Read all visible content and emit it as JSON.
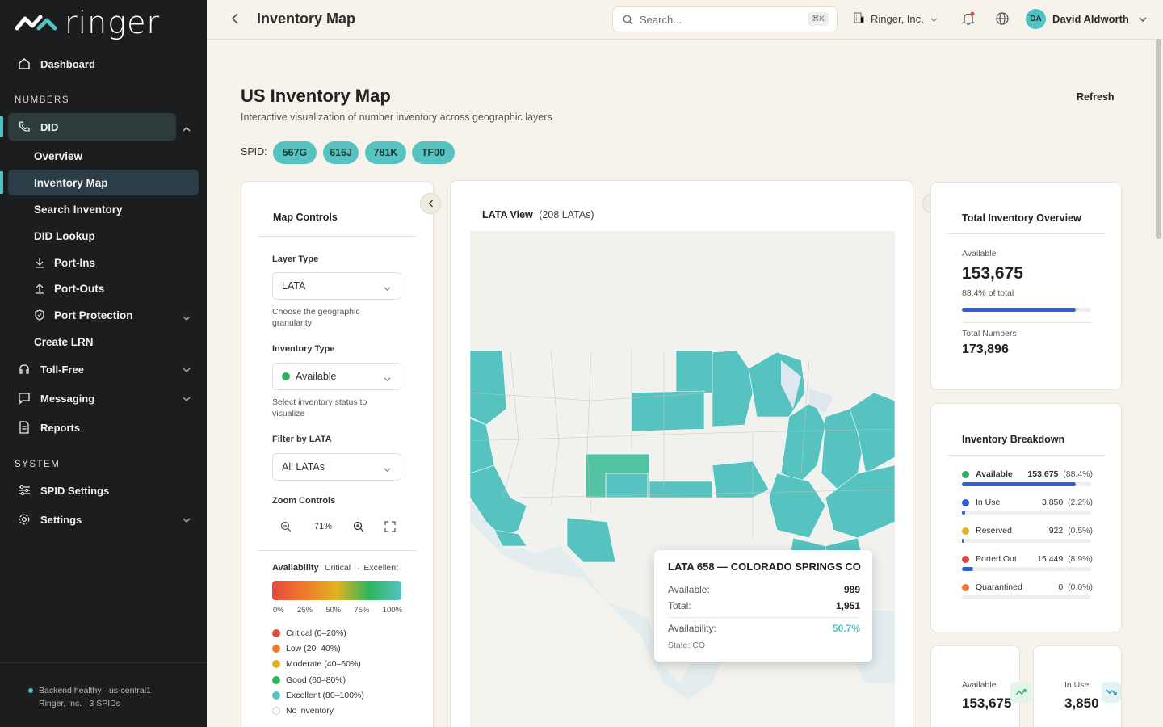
{
  "app": {
    "name": "ringer"
  },
  "sidebar": {
    "dashboard": "Dashboard",
    "numbers_section": "NUMBERS",
    "did": "DID",
    "did_items": [
      "Overview",
      "Inventory Map",
      "Search Inventory",
      "DID Lookup",
      "Port-Ins",
      "Port-Outs",
      "Port Protection",
      "Create LRN"
    ],
    "toll_free": "Toll-Free",
    "messaging": "Messaging",
    "reports": "Reports",
    "system_section": "SYSTEM",
    "spid_settings": "SPID Settings",
    "settings": "Settings",
    "footer": {
      "status": "Backend healthy · us-central1",
      "org": "Ringer, Inc. · 3 SPIDs"
    }
  },
  "topbar": {
    "title": "Inventory Map",
    "search_placeholder": "Search...",
    "search_shortcut": "⌘K",
    "org": "Ringer, Inc.",
    "user_initials": "DA",
    "user_name": "David Aldworth"
  },
  "page": {
    "title": "US Inventory Map",
    "subtitle": "Interactive visualization of number inventory across geographic layers",
    "refresh": "Refresh",
    "spid_label": "SPID:",
    "spids": [
      "567G",
      "616J",
      "781K",
      "TF00"
    ]
  },
  "controls": {
    "title": "Map Controls",
    "layer_type_label": "Layer Type",
    "layer_type_value": "LATA",
    "layer_type_hint": "Choose the geographic granularity",
    "inventory_type_label": "Inventory Type",
    "inventory_type_value": "Available",
    "inventory_type_hint": "Select inventory status to visualize",
    "filter_label": "Filter by LATA",
    "filter_value": "All LATAs",
    "zoom_label": "Zoom Controls",
    "zoom_value": "71%",
    "availability_label": "Availability",
    "availability_range": "Critical → Excellent",
    "scale_ticks": [
      "0%",
      "25%",
      "50%",
      "75%",
      "100%"
    ],
    "legend": [
      {
        "label": "Critical (0–20%)",
        "color": "#e5483f"
      },
      {
        "label": "Low (20–40%)",
        "color": "#f0792a"
      },
      {
        "label": "Moderate (40–60%)",
        "color": "#e2b321"
      },
      {
        "label": "Good (60–80%)",
        "color": "#2db55d"
      },
      {
        "label": "Excellent (80–100%)",
        "color": "#56c3c0"
      },
      {
        "label": "No inventory",
        "color": "#ffffff"
      }
    ]
  },
  "map_view": {
    "title": "LATA View",
    "count": "(208 LATAs)",
    "tooltip": {
      "title": "LATA 658 — COLORADO SPRINGS CO",
      "available_label": "Available:",
      "available_value": "989",
      "total_label": "Total:",
      "total_value": "1,951",
      "availability_label": "Availability:",
      "availability_value": "50.7%",
      "state": "State: CO"
    }
  },
  "overview": {
    "title": "Total Inventory Overview",
    "available_label": "Available",
    "available_value": "153,675",
    "available_pct": "88.4% of total",
    "available_fraction": 0.884,
    "total_label": "Total Numbers",
    "total_value": "173,896"
  },
  "breakdown": {
    "title": "Inventory Breakdown",
    "rows": [
      {
        "name": "Available",
        "value": "153,675",
        "pct": "(88.4%)",
        "fraction": 0.884,
        "color": "#2db55d"
      },
      {
        "name": "In Use",
        "value": "3,850",
        "pct": "(2.2%)",
        "fraction": 0.022,
        "color": "#2f5fd8"
      },
      {
        "name": "Reserved",
        "value": "922",
        "pct": "(0.5%)",
        "fraction": 0.005,
        "color": "#e2b321"
      },
      {
        "name": "Ported Out",
        "value": "15,449",
        "pct": "(8.9%)",
        "fraction": 0.089,
        "color": "#e5483f"
      },
      {
        "name": "Quarantined",
        "value": "0",
        "pct": "(0.0%)",
        "fraction": 0.0,
        "color": "#f0792a"
      }
    ]
  },
  "mini_cards": [
    {
      "label": "Available",
      "value": "153,675"
    },
    {
      "label": "In Use",
      "value": "3,850"
    }
  ]
}
